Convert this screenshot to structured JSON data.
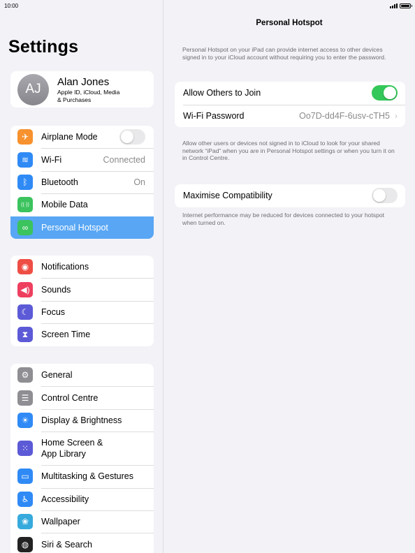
{
  "status": {
    "time": "10:00"
  },
  "sidebar": {
    "title": "Settings",
    "profile": {
      "initials": "AJ",
      "name": "Alan Jones",
      "subtitle_line1": "Apple ID, iCloud, Media",
      "subtitle_line2": "& Purchases"
    },
    "group1": [
      {
        "label": "Airplane Mode",
        "icon": "airplane-icon",
        "color": "#f7922f",
        "glyph": "✈",
        "toggle": false
      },
      {
        "label": "Wi-Fi",
        "icon": "wifi-icon",
        "color": "#2f8af5",
        "glyph": "≋",
        "value": "Connected"
      },
      {
        "label": "Bluetooth",
        "icon": "bluetooth-icon",
        "color": "#2f8af5",
        "glyph": "ᛒ",
        "value": "On"
      },
      {
        "label": "Mobile Data",
        "icon": "antenna-icon",
        "color": "#3bc35d",
        "glyph": "((·))"
      },
      {
        "label": "Personal Hotspot",
        "icon": "hotspot-icon",
        "color": "#3bc35d",
        "glyph": "∞",
        "selected": true
      }
    ],
    "group2": [
      {
        "label": "Notifications",
        "icon": "bell-icon",
        "color": "#ee4e44",
        "glyph": "◉"
      },
      {
        "label": "Sounds",
        "icon": "speaker-icon",
        "color": "#ee3f5f",
        "glyph": "◀)"
      },
      {
        "label": "Focus",
        "icon": "moon-icon",
        "color": "#5c5ad6",
        "glyph": "☾"
      },
      {
        "label": "Screen Time",
        "icon": "hourglass-icon",
        "color": "#5c5ad6",
        "glyph": "⧗"
      }
    ],
    "group3": [
      {
        "label": "General",
        "icon": "gear-icon",
        "color": "#8e8e93",
        "glyph": "⚙"
      },
      {
        "label": "Control Centre",
        "icon": "switches-icon",
        "color": "#8e8e93",
        "glyph": "☰"
      },
      {
        "label": "Display & Brightness",
        "icon": "sun-icon",
        "color": "#2f8af5",
        "glyph": "☀"
      },
      {
        "label": "Home Screen &\nApp Library",
        "icon": "grid-icon",
        "color": "#5c5ad6",
        "glyph": "⁙",
        "tall": true
      },
      {
        "label": "Multitasking & Gestures",
        "icon": "multitask-icon",
        "color": "#2f8af5",
        "glyph": "▭"
      },
      {
        "label": "Accessibility",
        "icon": "accessibility-icon",
        "color": "#2f8af5",
        "glyph": "♿"
      },
      {
        "label": "Wallpaper",
        "icon": "flower-icon",
        "color": "#36aadc",
        "glyph": "❀"
      },
      {
        "label": "Siri & Search",
        "icon": "siri-icon",
        "color": "#222222",
        "glyph": "◍"
      }
    ]
  },
  "main": {
    "title": "Personal Hotspot",
    "intro": "Personal Hotspot on your iPad can provide internet access to other devices signed in to your iCloud account without requiring you to enter the password.",
    "allow_label": "Allow Others to Join",
    "allow_on": true,
    "wifi_password_label": "Wi-Fi Password",
    "wifi_password_value": "Oo7D-dd4F-6usv-cTH5",
    "allow_note": "Allow other users or devices not signed in to iCloud to look for your shared network “iPad” when you are in Personal Hotspot settings or when you turn it on in Control Centre.",
    "compat_label": "Maximise Compatibility",
    "compat_on": false,
    "compat_note": "Internet performance may be reduced for devices connected to your hotspot when turned on."
  }
}
